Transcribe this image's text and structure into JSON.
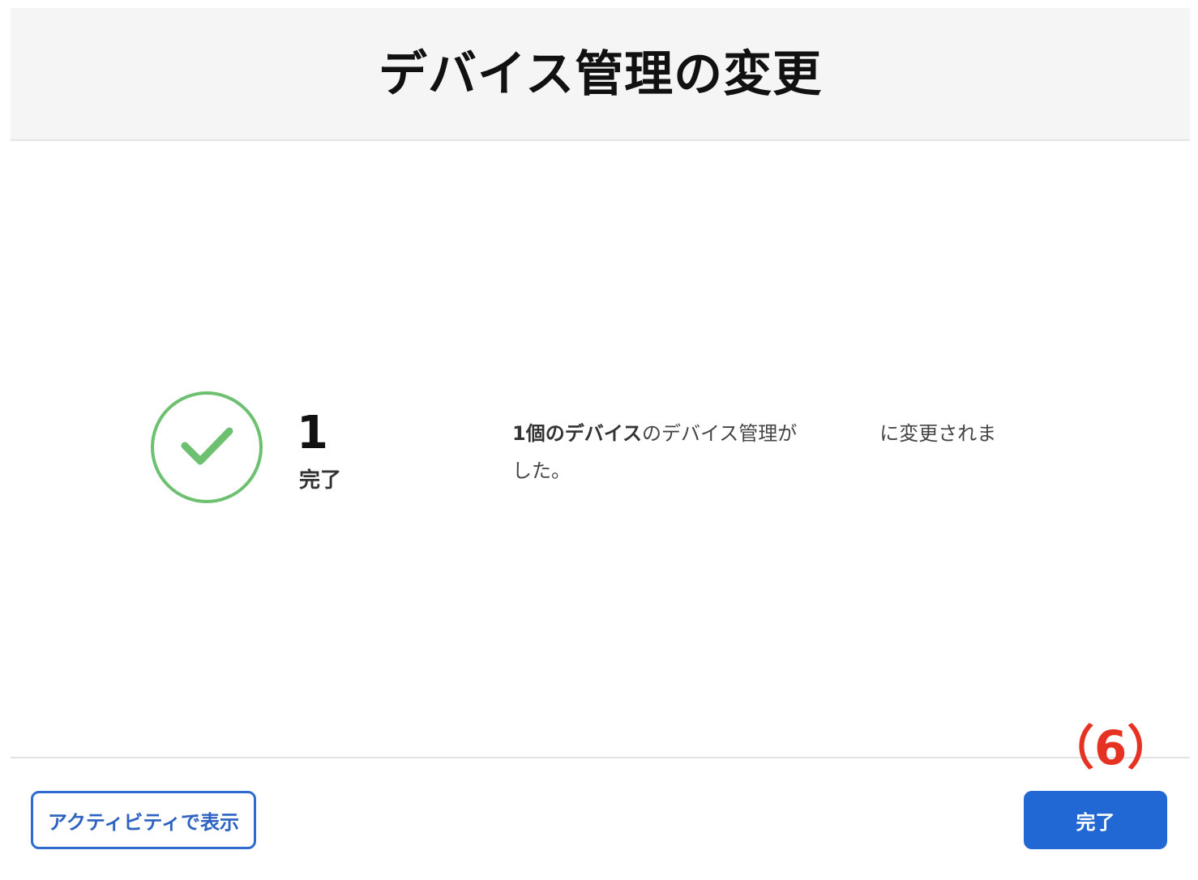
{
  "header": {
    "title": "デバイス管理の変更"
  },
  "result": {
    "status_icon": "check-circle-icon",
    "count": "1",
    "count_label": "完了",
    "message_bold": "1個のデバイス",
    "message_part1": "のデバイス管理が",
    "message_part2": "に変更されま",
    "message_part3": "した。"
  },
  "footer": {
    "activity_button": "アクティビティで表示",
    "done_button": "完了",
    "step_annotation": "（6）"
  },
  "colors": {
    "success": "#6cc070",
    "primary": "#2168d4",
    "annotation": "#e53222"
  }
}
